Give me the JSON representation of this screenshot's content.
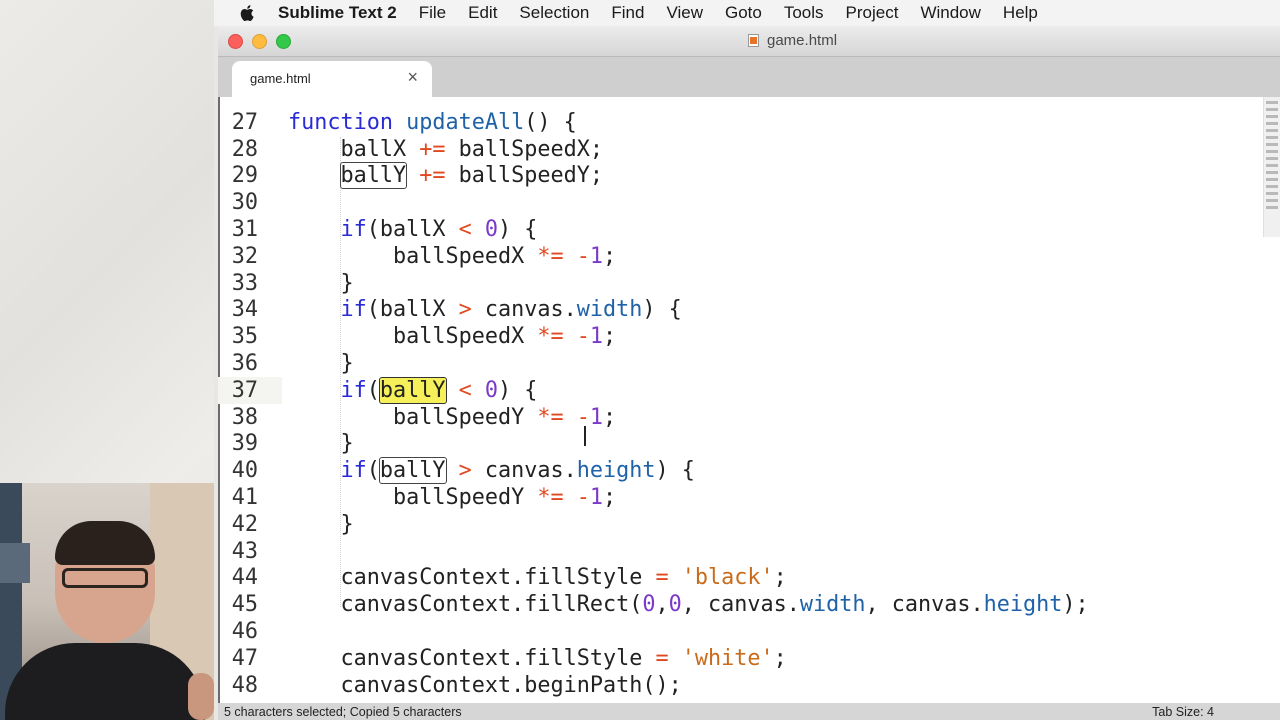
{
  "menubar": {
    "app_name": "Sublime Text 2",
    "items": [
      "File",
      "Edit",
      "Selection",
      "Find",
      "View",
      "Goto",
      "Tools",
      "Project",
      "Window",
      "Help"
    ]
  },
  "window": {
    "title": "game.html"
  },
  "tab": {
    "label": "game.html",
    "close": "×"
  },
  "editor": {
    "current_line": 37,
    "lines": [
      {
        "n": "27"
      },
      {
        "n": "28"
      },
      {
        "n": "29"
      },
      {
        "n": "30"
      },
      {
        "n": "31"
      },
      {
        "n": "32"
      },
      {
        "n": "33"
      },
      {
        "n": "34"
      },
      {
        "n": "35"
      },
      {
        "n": "36"
      },
      {
        "n": "37"
      },
      {
        "n": "38"
      },
      {
        "n": "39"
      },
      {
        "n": "40"
      },
      {
        "n": "41"
      },
      {
        "n": "42"
      },
      {
        "n": "43"
      },
      {
        "n": "44"
      },
      {
        "n": "45"
      },
      {
        "n": "46"
      },
      {
        "n": "47"
      },
      {
        "n": "48"
      }
    ],
    "tokens": {
      "function": "function",
      "updateAll": "updateAll",
      "ballX": "ballX",
      "ballY": "ballY",
      "ballSpeedX": "ballSpeedX",
      "ballSpeedY": "ballSpeedY",
      "if": "if",
      "canvas": "canvas",
      "width": "width",
      "height": "height",
      "canvasContext": "canvasContext",
      "fillStyle": "fillStyle",
      "fillRect": "fillRect",
      "beginPath": "beginPath",
      "black": "'black'",
      "white": "'white'"
    }
  },
  "statusbar": {
    "left": "5 characters selected; Copied 5 characters",
    "right": "Tab Size: 4"
  }
}
